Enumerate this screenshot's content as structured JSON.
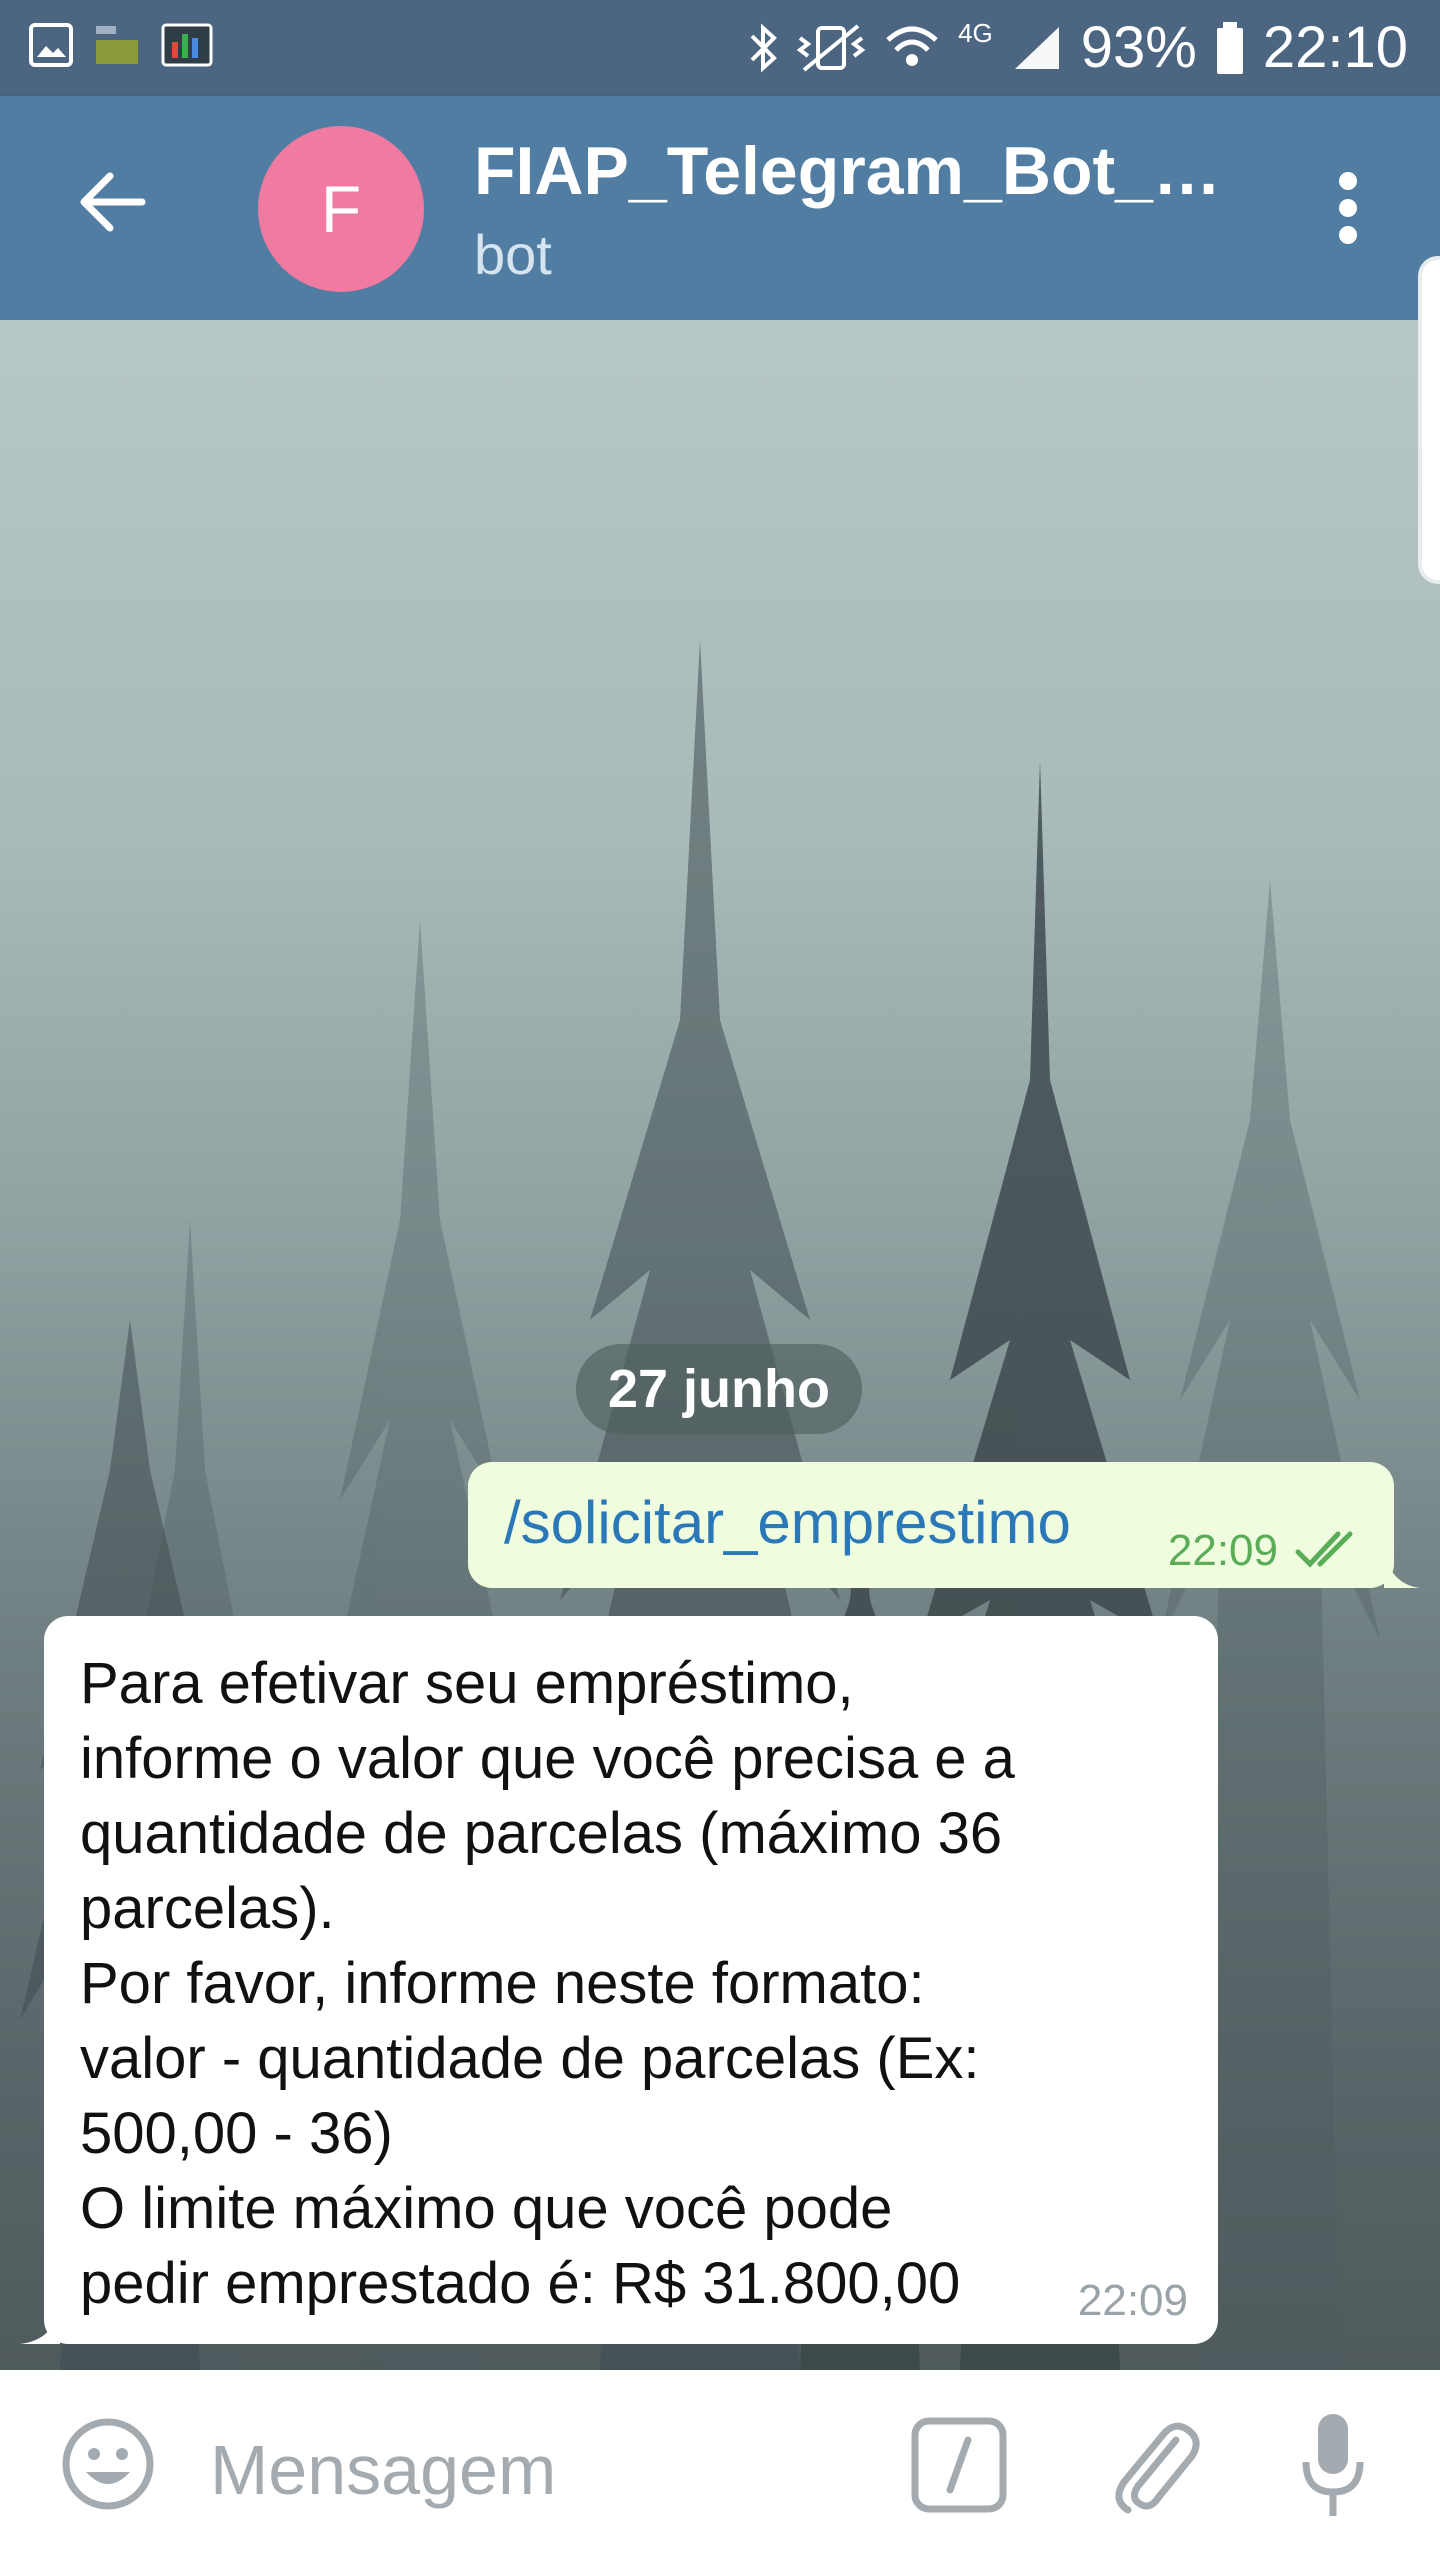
{
  "status_bar": {
    "battery_percent": "93%",
    "network_label": "4G",
    "time": "22:10",
    "notif_icons": [
      "image-icon",
      "data-icon",
      "chart-app-icon"
    ],
    "system_icons": [
      "bluetooth-icon",
      "vibrate-icon",
      "wifi-icon",
      "signal-icon",
      "battery-icon"
    ]
  },
  "header": {
    "avatar_letter": "F",
    "title": "FIAP_Telegram_Bot_D...",
    "subtitle": "bot",
    "colors": {
      "bar": "#517da2",
      "avatar": "#f07aa0"
    }
  },
  "chat": {
    "date_label": "27 junho",
    "messages": [
      {
        "direction": "out",
        "text": "/solicitar_emprestimo",
        "time": "22:09",
        "status": "read"
      },
      {
        "direction": "in",
        "lines": [
          "Para efetivar seu empréstimo,",
          "informe o valor que você precisa e a",
          "quantidade de parcelas (máximo 36",
          "parcelas).",
          "Por favor, informe neste formato:",
          "valor - quantidade de parcelas (Ex:",
          "500,00 - 36)",
          "O limite máximo que você pode",
          "pedir emprestado é: R$ 31.800,00"
        ],
        "time": "22:09"
      }
    ]
  },
  "composer": {
    "placeholder": "Mensagem",
    "icons": [
      "emoji-icon",
      "bot-command-icon",
      "attach-icon",
      "mic-icon"
    ]
  }
}
